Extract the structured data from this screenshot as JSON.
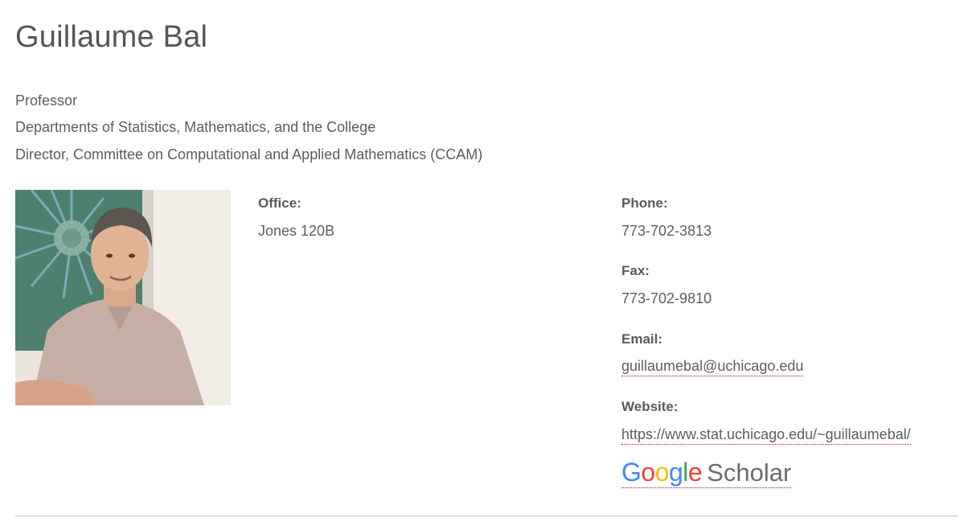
{
  "profile": {
    "name": "Guillaume Bal",
    "roles": [
      "Professor",
      "Departments of Statistics, Mathematics, and the College",
      "Director, Committee on Computational and Applied Mathematics (CCAM)"
    ]
  },
  "contact": {
    "office_label": "Office:",
    "office_value": "Jones 120B",
    "phone_label": "Phone:",
    "phone_value": "773-702-3813",
    "fax_label": "Fax:",
    "fax_value": "773-702-9810",
    "email_label": "Email:",
    "email_value": "guillaumebal@uchicago.edu",
    "website_label": "Website:",
    "website_value": "https://www.stat.uchicago.edu/~guillaumebal/"
  },
  "scholar_logo": {
    "letters": [
      "G",
      "o",
      "o",
      "g",
      "l",
      "e"
    ],
    "letter_colors": [
      "#4285F4",
      "#EA4335",
      "#FBBC05",
      "#4285F4",
      "#34A853",
      "#EA4335"
    ],
    "word": "Scholar",
    "icon": "google-scholar-logo"
  },
  "theme": {
    "text": "#5d5d5d",
    "link_underline": "#8a1e1e",
    "divider": "#bdbdbd"
  }
}
